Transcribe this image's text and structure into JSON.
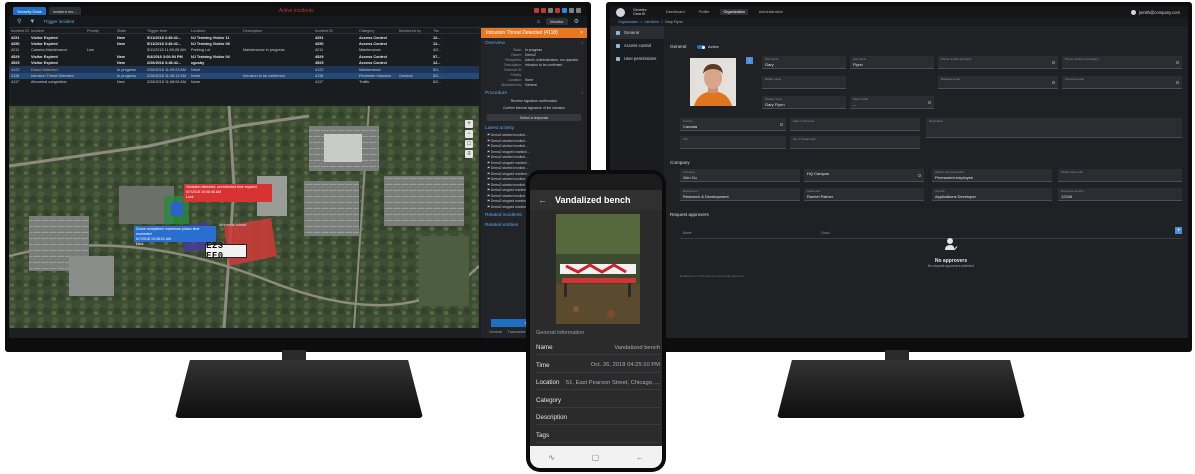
{
  "left_app": {
    "tabs": [
      "Security Desk",
      "Incident mo..."
    ],
    "window_title": "Active incidents",
    "toolbar": {
      "trigger_label": "Trigger incident",
      "monitor_label": "Monitor"
    },
    "grid": {
      "headers": [
        "Incident ID",
        "Incident",
        "Priority",
        "State",
        "Trigger time",
        "Location",
        "Description",
        "Incident ID",
        "Category",
        "Monitored by",
        "Tim"
      ],
      "rows": [
        {
          "id": "4251",
          "name": "Visitor Expired",
          "priority": "",
          "state": "New",
          "time": "5/11/2018 3:48:42...",
          "location": "NJ Training Visitor 11",
          "desc": "",
          "category": "Access Control",
          "mon": "",
          "t": "12...",
          "style": "bold"
        },
        {
          "id": "4250",
          "name": "Visitor Expired",
          "priority": "",
          "state": "New",
          "time": "5/11/2018 3:48:42...",
          "location": "NJ Training Visitor 08",
          "desc": "",
          "category": "Access Control",
          "mon": "",
          "t": "12...",
          "style": "bold"
        },
        {
          "id": "4211",
          "name": "Camera Maintenance",
          "priority": "Low",
          "state": "",
          "time": "5/11/2018 11:59:28 AM",
          "location": "Parking Lot",
          "desc": "Maintenance in progress",
          "category": "Maintenance",
          "mon": "",
          "t": "4/2...",
          "style": ""
        },
        {
          "id": "4529",
          "name": "Visitor Expired",
          "priority": "",
          "state": "New",
          "time": "6/4/2018 3:00:54 PM",
          "location": "NJ Training Visitor 04",
          "desc": "",
          "category": "Access Control",
          "mon": "",
          "t": "57...",
          "style": "bold"
        },
        {
          "id": "4525",
          "name": "Visitor Expired",
          "priority": "",
          "state": "New",
          "time": "2/26/2018 3:48:42...",
          "location": "cgosby",
          "desc": "",
          "category": "Access Control",
          "mon": "",
          "t": "12...",
          "style": "bold"
        },
        {
          "id": "4122",
          "name": "Drone Detected",
          "priority": "",
          "state": "In progress",
          "time": "2/28/2018 11:09:03 AM",
          "location": "None",
          "desc": "",
          "category": "Maintenance",
          "mon": "",
          "t": "5/1...",
          "style": "blue"
        },
        {
          "id": "4118",
          "name": "Intrusion Threat Detected",
          "priority": "",
          "state": "In progress",
          "time": "2/28/2018 11:08:12 AM",
          "location": "None",
          "desc": "Intrusion to be confirmed",
          "category": "Perimeter Intrusion",
          "mon": "General",
          "t": "5/2...",
          "style": "sel"
        },
        {
          "id": "4117",
          "name": "Abnormal congestion",
          "priority": "",
          "state": "New",
          "time": "2/28/2018 11:08:06 AM",
          "location": "None",
          "desc": "",
          "category": "Traffic",
          "mon": "",
          "t": "8/2...",
          "style": ""
        }
      ]
    },
    "map": {
      "alert_red": [
        "Visitation detected: unrestricted time expired",
        "6/7/2018 10:08:46 AM",
        "Lock"
      ],
      "alert_blue": [
        "Drone completed: maximum phase time exceeded",
        "6/7/2018 10:08:01 AM",
        "Lock"
      ],
      "plate": "E23 EF0",
      "place_label": "Montreal Island"
    },
    "panel": {
      "header": "Intrusion Threat Detected (4118)",
      "overview": "Overview",
      "fields": [
        {
          "k": "State:",
          "v": "In progress"
        },
        {
          "k": "Owner:",
          "v": "Demo2"
        },
        {
          "k": "Recipients:",
          "v": "Admin, Administrators, run operator"
        },
        {
          "k": "Description:",
          "v": "Intrusion to be confirmed"
        },
        {
          "k": "External ID:",
          "v": ""
        },
        {
          "k": "Priority:",
          "v": ""
        },
        {
          "k": "Location:",
          "v": "None"
        },
        {
          "k": "Monitored by:",
          "v": "General"
        }
      ],
      "procedure": "Procedure",
      "procedure_lines": [
        "Receive signature confirmation",
        "Confirm thermal signature of the intrusion"
      ],
      "select_response": "Select a response",
      "latest_activity": "Latest activity",
      "activities": [
        "Demo2 started monitori...",
        "Demo2 started monitori...",
        "Demo2 started monitori...",
        "Demo2 stopped monitori...",
        "Demo2 started monitori...",
        "Demo2 stopped monitori...",
        "Demo2 started monitori...",
        "Demo2 stopped monitori...",
        "Demo2 started monitori...",
        "Demo2 started monitori...",
        "Demo2 stopped monitori...",
        "Demo2 started monitori...",
        "Demo2 stopped monitori...",
        "Demo2 stopped monitori..."
      ],
      "related_incidents": "Related incidents",
      "related_entities": "Related entities",
      "change_button": "Change curr...",
      "bottom_tabs": [
        "General",
        "Transaction"
      ]
    }
  },
  "right_app": {
    "brand": "Genetec ClearID",
    "nav": [
      "Dashboard",
      "Profile",
      "Organization",
      "Administration"
    ],
    "active_nav": "Organization",
    "user": "jsmith@company.com",
    "breadcrumb": [
      "Organization",
      "Identities",
      "Gary Flynn"
    ],
    "side_items": [
      "General",
      "Access control",
      "User permissions"
    ],
    "general_title": "General",
    "active_label": "Active",
    "fields": {
      "first_name": {
        "label": "First name",
        "value": "Gary"
      },
      "last_name": {
        "label": "Last name",
        "value": "Flynn"
      },
      "phone_primary": {
        "label": "Phone number (primary)",
        "value": ""
      },
      "phone_secondary": {
        "label": "Phone number (secondary)",
        "value": ""
      },
      "middle_name": {
        "label": "Middle name",
        "value": ""
      },
      "business_email": {
        "label": "Business email",
        "value": ""
      },
      "personal_email": {
        "label": "Personal email",
        "value": ""
      },
      "display_name": {
        "label": "Display name",
        "value": "Gary Flynn"
      },
      "date_of_birth": {
        "label": "Date of birth",
        "value": "--"
      },
      "country": {
        "label": "Country",
        "value": "Canada"
      },
      "state": {
        "label": "State or Province",
        "value": ""
      },
      "description": {
        "label": "Description",
        "value": ""
      },
      "city": {
        "label": "City",
        "value": ""
      },
      "zip": {
        "label": "Zip or Postal code",
        "value": ""
      }
    },
    "company_title": "Company",
    "company_fields": {
      "company": {
        "label": "Company",
        "value": "Gen Co"
      },
      "location": {
        "label": "",
        "value": "HQ Campus"
      },
      "worker_type": {
        "label": "Worker type description",
        "value": "Permanent employee"
      },
      "worker_type_code": {
        "label": "Worker type code",
        "value": ""
      },
      "department": {
        "label": "Department",
        "value": "Research & Development"
      },
      "supervisor": {
        "label": "Supervisor",
        "value": "Rachel Palmer"
      },
      "job_title": {
        "label": "Job title",
        "value": "Applications Developer"
      },
      "employee_number": {
        "label": "Employee number",
        "value": "12345"
      }
    },
    "approvers_title": "Request approvers",
    "approvers_headers": [
      "Name",
      "Email"
    ],
    "no_approvers": "No approvers",
    "no_approvers_sub": "No request approvers selected",
    "footnote": "Requests from this user do not require approval"
  },
  "phone_app": {
    "title": "Vandalized bench",
    "section": "General information",
    "rows": [
      {
        "k": "Name",
        "v": "Vandalized bench"
      },
      {
        "k": "Time",
        "v": "Oct. 26, 2018 04:25:10 PM"
      },
      {
        "k": "Location",
        "v": "51, East Pearson Street, Chicago, ..."
      },
      {
        "k": "Category",
        "v": ""
      },
      {
        "k": "Description",
        "v": ""
      },
      {
        "k": "Tags",
        "v": ""
      }
    ]
  },
  "colors": {
    "accent_blue": "#1f6fc2",
    "incident_orange": "#e87722",
    "alert_red": "#d93232"
  }
}
